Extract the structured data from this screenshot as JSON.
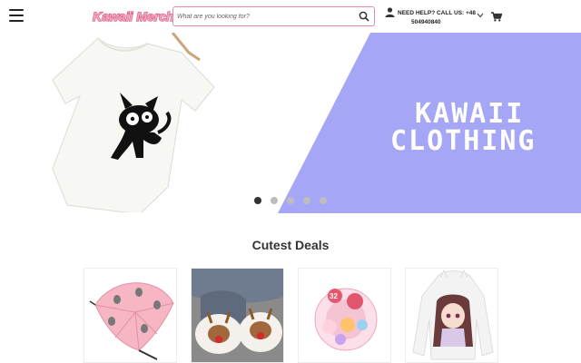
{
  "header": {
    "logo_text": "Kawaii Merch",
    "search_placeholder": "What are you looking for?",
    "help_line1": "NEED HELP? CALL US: +48",
    "help_line2": "504940840"
  },
  "hero": {
    "title_line1": "KAWAII",
    "title_line2": "CLOTHING",
    "accent_color": "#a5a6f6",
    "slide_count": 5,
    "active_slide": 1
  },
  "deals": {
    "title": "Cutest Deals",
    "products": [
      {
        "icon": "pink-totoro-umbrella"
      },
      {
        "icon": "reindeer-slippers"
      },
      {
        "icon": "stickers-pack"
      },
      {
        "icon": "anime-girl-hoodie"
      }
    ]
  },
  "colors": {
    "brand_pink": "#e67ca0",
    "hero_purple": "#a5a6f6"
  }
}
